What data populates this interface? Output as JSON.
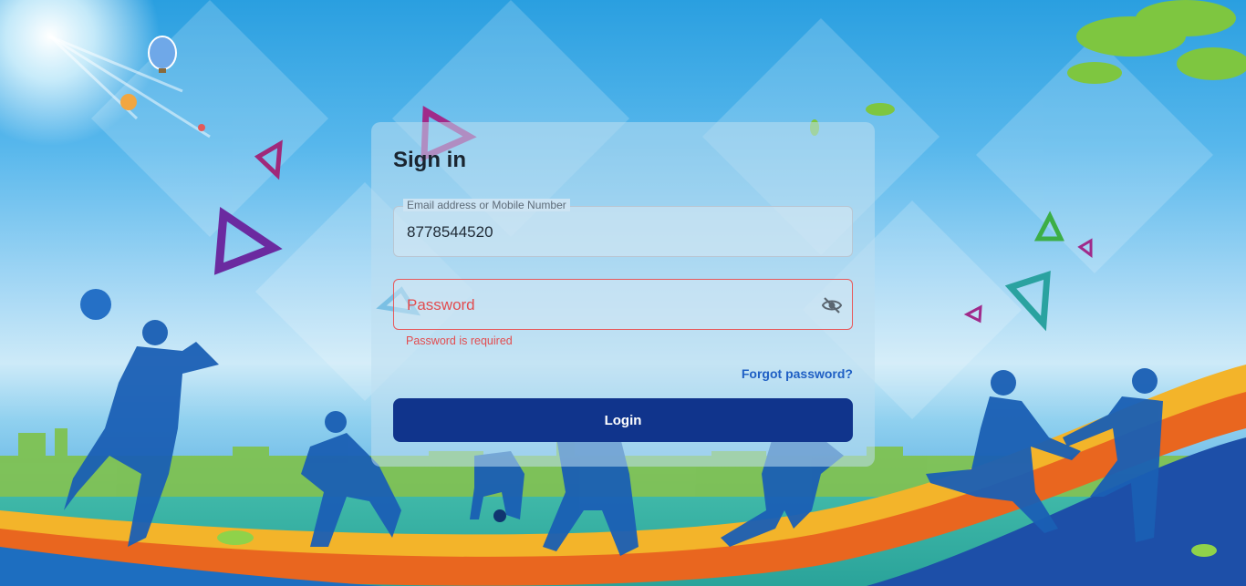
{
  "signin": {
    "title": "Sign in",
    "email_label": "Email address or Mobile Number",
    "email_value": "8778544520",
    "password_placeholder": "Password",
    "password_error": "Password is required",
    "forgot_label": "Forgot password?",
    "login_label": "Login"
  },
  "colors": {
    "primary_button": "#10348c",
    "link": "#1f5fc4",
    "error": "#e24c4f"
  },
  "icons": {
    "password_toggle": "eye-off-icon"
  }
}
